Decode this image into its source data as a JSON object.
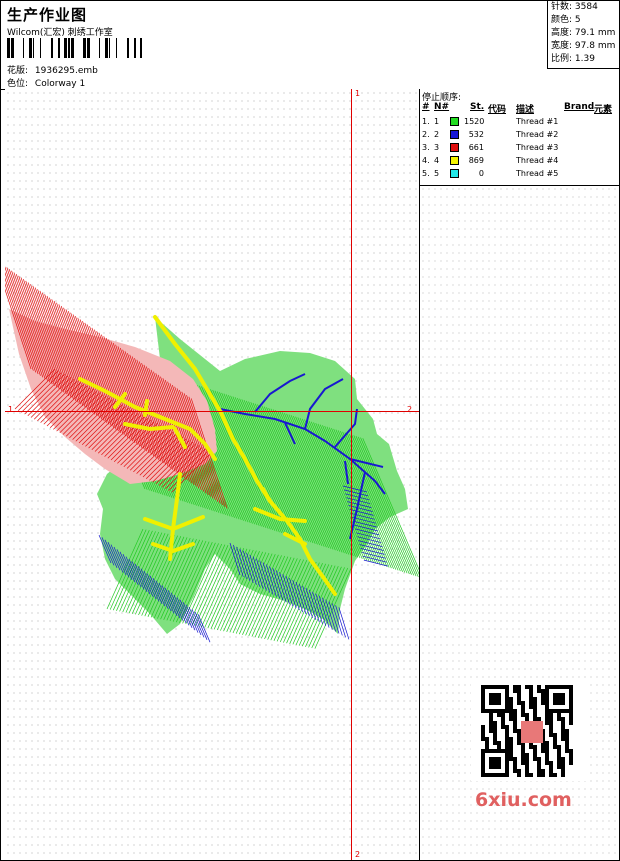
{
  "header": {
    "title": "生产作业图",
    "company": "Wilcom(汇宏) 刺绣工作室",
    "design_label": "花版:",
    "design_value": "1936295.emb",
    "colorway_label": "色位:",
    "colorway_value": "Colorway 1"
  },
  "stats": [
    {
      "label": "针数:",
      "value": "3584"
    },
    {
      "label": "颜色:",
      "value": "5"
    },
    {
      "label": "高度:",
      "value": "79.1 mm"
    },
    {
      "label": "宽度:",
      "value": "97.8 mm"
    },
    {
      "label": "比例:",
      "value": "1.39"
    }
  ],
  "threads": {
    "title": "停止顺序:",
    "headers": {
      "num": "#",
      "n": "N#",
      "st": "St.",
      "code": "代码",
      "desc": "描述",
      "brand": "Brand",
      "element": "元素"
    },
    "rows": [
      {
        "num": "1.",
        "n": "1",
        "color": "#22dd22",
        "st": "1520",
        "desc": "Thread #1"
      },
      {
        "num": "2.",
        "n": "2",
        "color": "#1616d8",
        "st": "532",
        "desc": "Thread #2"
      },
      {
        "num": "3.",
        "n": "3",
        "color": "#e01010",
        "st": "661",
        "desc": "Thread #3"
      },
      {
        "num": "4.",
        "n": "4",
        "color": "#f4f400",
        "st": "869",
        "desc": "Thread #4"
      },
      {
        "num": "5.",
        "n": "5",
        "color": "#22e8e8",
        "st": "0",
        "desc": "Thread #5"
      }
    ]
  },
  "axis": {
    "top": "1",
    "bottom": "2",
    "left": "1",
    "right": "2",
    "color": "#e00000"
  },
  "watermark": "6xiu.com"
}
